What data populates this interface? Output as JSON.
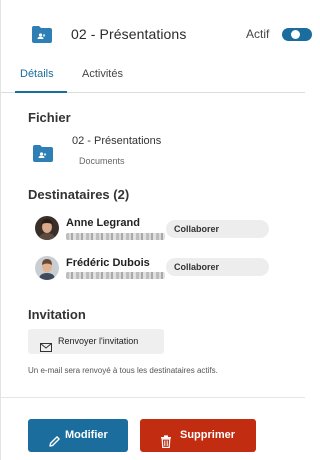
{
  "header": {
    "title": "02 - Présentations",
    "status_label": "Actif",
    "status_on": true
  },
  "tabs": [
    {
      "label": "Détails",
      "active": true
    },
    {
      "label": "Activités",
      "active": false
    }
  ],
  "file": {
    "section_title": "Fichier",
    "name": "02 - Présentations",
    "folder": "Documents",
    "icon": "shared-folder-icon"
  },
  "recipients": {
    "section_title": "Destinataires (2)",
    "items": [
      {
        "name": "Anne Legrand",
        "role": "Collaborer",
        "avatar": "avatar-woman"
      },
      {
        "name": "Frédéric Dubois",
        "role": "Collaborer",
        "avatar": "avatar-man"
      }
    ]
  },
  "invitation": {
    "section_title": "Invitation",
    "resend_label": "Renvoyer l'invitation",
    "info_text": "Un e-mail sera renvoyé à tous les destinataires actifs."
  },
  "actions": {
    "edit_label": "Modifier",
    "delete_label": "Supprimer"
  },
  "colors": {
    "accent": "#1a6d9d",
    "folder": "#2d7fb5",
    "danger": "#c22d12"
  }
}
